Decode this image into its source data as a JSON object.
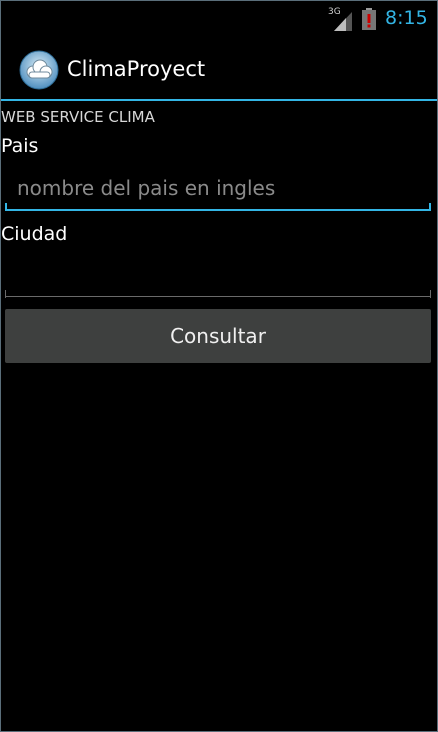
{
  "status_bar": {
    "network_type": "3G",
    "time": "8:15",
    "signal_icon": "signal-icon",
    "battery_icon": "battery-alert-icon",
    "accent_color": "#33b5e5",
    "battery_alert_color": "#cc0000"
  },
  "action_bar": {
    "title": "ClimaProyect",
    "icon": "cloud-app-icon"
  },
  "form": {
    "section_title": "WEB SERVICE CLIMA",
    "country_label": "Pais",
    "country_value": "",
    "country_placeholder": "nombre del pais en ingles",
    "city_label": "Ciudad",
    "city_value": "",
    "city_placeholder": "",
    "submit_label": "Consultar"
  }
}
